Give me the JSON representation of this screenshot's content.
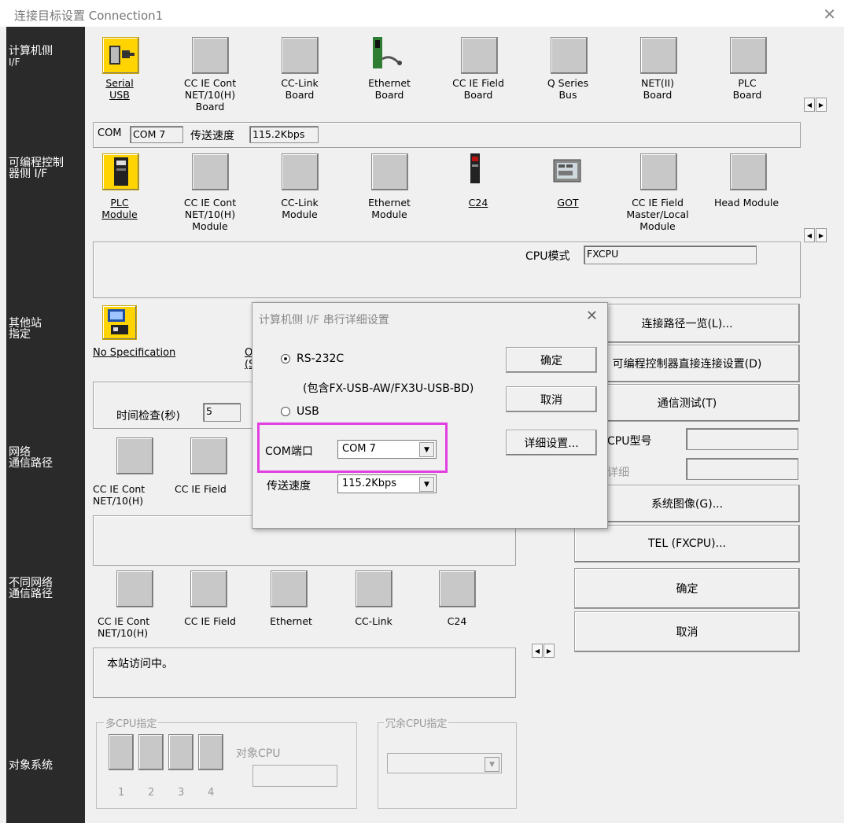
{
  "window": {
    "title": "连接目标设置 Connection1",
    "close_icon": "close-icon"
  },
  "sidebar": {
    "pc_if": {
      "line1": "计算机侧",
      "line2": "I/F"
    },
    "plc_if": {
      "line1": "可编程控制",
      "line2": "器侧 I/F"
    },
    "other_station": {
      "line1": "其他站",
      "line2": "指定"
    },
    "network_route": {
      "line1": "网络",
      "line2": "通信路径"
    },
    "diff_network_route": {
      "line1": "不同网络",
      "line2": "通信路径"
    },
    "target_system": {
      "line1": "对象系统"
    }
  },
  "pc_if_icons": [
    {
      "l1": "Serial",
      "l2": "USB",
      "l3": ""
    },
    {
      "l1": "CC IE Cont",
      "l2": "NET/10(H)",
      "l3": "Board"
    },
    {
      "l1": "CC-Link",
      "l2": "Board",
      "l3": ""
    },
    {
      "l1": "Ethernet",
      "l2": "Board",
      "l3": ""
    },
    {
      "l1": "CC IE Field",
      "l2": "Board",
      "l3": ""
    },
    {
      "l1": "Q Series",
      "l2": "Bus",
      "l3": ""
    },
    {
      "l1": "NET(II)",
      "l2": "Board",
      "l3": ""
    },
    {
      "l1": "PLC",
      "l2": "Board",
      "l3": ""
    }
  ],
  "pc_if_status": {
    "com_label": "COM",
    "com_value": "COM 7",
    "speed_label": "传送速度",
    "speed_value": "115.2Kbps"
  },
  "plc_if_icons": [
    {
      "l1": "PLC",
      "l2": "Module",
      "l3": ""
    },
    {
      "l1": "CC IE Cont",
      "l2": "NET/10(H)",
      "l3": "Module"
    },
    {
      "l1": "CC-Link",
      "l2": "Module",
      "l3": ""
    },
    {
      "l1": "Ethernet",
      "l2": "Module",
      "l3": ""
    },
    {
      "l1": "C24",
      "l2": "",
      "l3": ""
    },
    {
      "l1": "GOT",
      "l2": "",
      "l3": ""
    },
    {
      "l1": "CC IE Field",
      "l2": "Master/Local",
      "l3": "Module"
    },
    {
      "l1": "Head Module",
      "l2": "",
      "l3": ""
    }
  ],
  "plc_status": {
    "cpu_mode_label": "CPU模式",
    "cpu_mode_value": "FXCPU"
  },
  "other_station": {
    "no_spec": "No Specification",
    "partial1": "O",
    "partial2": "(S",
    "time_check_label": "时间检查(秒)",
    "time_check_value": "5"
  },
  "network_icons": [
    {
      "l1": "CC IE Cont",
      "l2": "NET/10(H)"
    },
    {
      "l1": "CC IE Field",
      "l2": ""
    }
  ],
  "diff_network_icons": [
    {
      "l1": "CC IE Cont",
      "l2": "NET/10(H)"
    },
    {
      "l1": "CC IE Field",
      "l2": ""
    },
    {
      "l1": "Ethernet",
      "l2": ""
    },
    {
      "l1": "CC-Link",
      "l2": ""
    },
    {
      "l1": "C24",
      "l2": ""
    }
  ],
  "status_message": "本站访问中。",
  "multi_cpu": {
    "title": "多CPU指定",
    "target_cpu": "对象CPU",
    "nums": [
      "1",
      "2",
      "3",
      "4"
    ]
  },
  "redundant_cpu": {
    "title": "冗余CPU指定"
  },
  "right_buttons": {
    "route_list": "连接路径一览(L)...",
    "plc_direct": "可编程控制器直接连接设置(D)",
    "comm_test": "通信测试(T)",
    "cpu_type_label": "CPU型号",
    "detail_label": "详细",
    "system_image": "系统图像(G)...",
    "tel": "TEL (FXCPU)...",
    "ok": "确定",
    "cancel": "取消"
  },
  "dialog": {
    "title": "计算机侧 I/F 串行详细设置",
    "rs232c": "RS-232C",
    "rs232c_note": "(包含FX-USB-AW/FX3U-USB-BD)",
    "usb": "USB",
    "com_port_label": "COM端口",
    "com_port_value": "COM 7",
    "speed_label": "传送速度",
    "speed_value": "115.2Kbps",
    "ok": "确定",
    "cancel": "取消",
    "detail": "详细设置..."
  },
  "colors": {
    "highlight": "#e040e0",
    "sidebar": "#2a2a2a",
    "yellow": "#ffd400"
  }
}
